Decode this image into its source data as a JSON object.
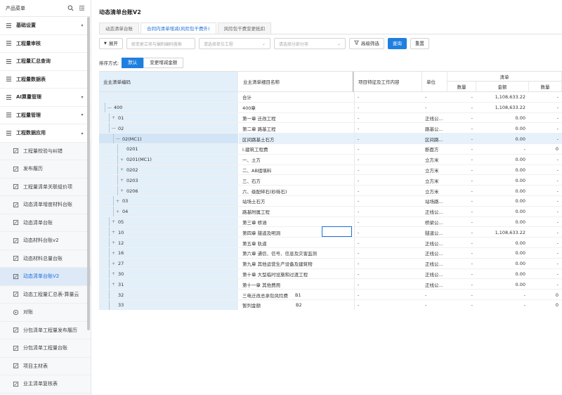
{
  "sidebar": {
    "title": "产品菜单",
    "items": [
      {
        "label": "基础设置",
        "level": 1,
        "arrow": "▾"
      },
      {
        "label": "工程量审核",
        "level": 1,
        "arrow": ""
      },
      {
        "label": "工程量汇总查询",
        "level": 1,
        "arrow": ""
      },
      {
        "label": "工程量数据表",
        "level": 1,
        "arrow": ""
      },
      {
        "label": "AI算量管理",
        "level": 1,
        "arrow": "▾"
      },
      {
        "label": "工程量管理",
        "level": 1,
        "arrow": "▾"
      },
      {
        "label": "工程数据应用",
        "level": 1,
        "arrow": "▴"
      },
      {
        "label": "工程量校验与纠错",
        "level": 2
      },
      {
        "label": "发布履历",
        "level": 2
      },
      {
        "label": "工程量清单关联组价项",
        "level": 2
      },
      {
        "label": "动态清单增度材料台账",
        "level": 2
      },
      {
        "label": "动态清单台账",
        "level": 2
      },
      {
        "label": "动态材料台账v2",
        "level": 2
      },
      {
        "label": "动态材料总量台账",
        "level": 2
      },
      {
        "label": "动态清单台账V2",
        "level": 2,
        "active": true
      },
      {
        "label": "动态工程量汇总表-算量云",
        "level": 2
      },
      {
        "label": "对账",
        "level": 2
      },
      {
        "label": "分包清单工程量发布履历",
        "level": 2
      },
      {
        "label": "分包清单工程量台账",
        "level": 2
      },
      {
        "label": "项目主材表",
        "level": 2
      },
      {
        "label": "业主清单复核表",
        "level": 2
      }
    ]
  },
  "page": {
    "title": "动态清单台账V2",
    "tabs": [
      "动态清单台账",
      "合同内清单增减(风险包干费外)",
      "风险包干费变更抵扣"
    ],
    "active_tab": 1
  },
  "toolbar": {
    "expand": "展开",
    "search_placeholder": "按变更立项与编制编码搜索",
    "unit_placeholder": "请选择单位工程",
    "sub_placeholder": "请选择分部分项",
    "advanced": "高级筛选",
    "query": "查询",
    "reset": "重置"
  },
  "sort": {
    "label": "排序方式:",
    "options": [
      "默认",
      "变更增减金额"
    ],
    "active": 0
  },
  "table": {
    "headers": {
      "code": "业主清单编码",
      "name": "业主清单细目名称",
      "feature": "项目特征及工作内容",
      "unit": "单位",
      "group": "清单",
      "qty": "数量",
      "amount": "金额",
      "qty2": "数量"
    },
    "rows": [
      {
        "code": "",
        "indent": 0,
        "name": "合计",
        "feature": "-",
        "unit": "-",
        "qty": "-",
        "amount": "1,108,633.22",
        "qty2": "-"
      },
      {
        "code": "400",
        "indent": 1,
        "toggle": "—",
        "name": "400章",
        "feature": "-",
        "unit": "-",
        "qty": "-",
        "amount": "1,108,633.22",
        "qty2": "-"
      },
      {
        "code": "01",
        "indent": 2,
        "toggle": "+",
        "name": "第一章 迁改工程",
        "feature": "-",
        "unit": "正线公...",
        "qty": "-",
        "amount": "0.00",
        "qty2": "-"
      },
      {
        "code": "02",
        "indent": 2,
        "toggle": "—",
        "name": "第二章 路基工程",
        "feature": "-",
        "unit": "路基公...",
        "qty": "-",
        "amount": "0.00",
        "qty2": "-"
      },
      {
        "code": "02(MC1)",
        "indent": 3,
        "toggle": "—",
        "name": "区间路基土石方",
        "feature": "-",
        "unit": "区间路...",
        "qty": "-",
        "amount": "0.00",
        "qty2": "-",
        "highlight": true
      },
      {
        "code": "0201",
        "indent": 4,
        "toggle": "",
        "name": "Ⅰ.建筑工程费",
        "feature": "-",
        "unit": "断面方",
        "qty": "-",
        "amount": "-",
        "qty2": "0"
      },
      {
        "code": "0201(MC1)",
        "indent": 4,
        "toggle": "+",
        "name": "一、土方",
        "feature": "-",
        "unit": "立方米",
        "qty": "-",
        "amount": "0.00",
        "qty2": "-"
      },
      {
        "code": "0202",
        "indent": 4,
        "toggle": "+",
        "name": "二、AB组填料",
        "feature": "-",
        "unit": "立方米",
        "qty": "-",
        "amount": "0.00",
        "qty2": "-"
      },
      {
        "code": "0203",
        "indent": 4,
        "toggle": "+",
        "name": "三、石方",
        "feature": "-",
        "unit": "立方米",
        "qty": "-",
        "amount": "0.00",
        "qty2": "-"
      },
      {
        "code": "0206",
        "indent": 4,
        "toggle": "+",
        "name": "六、级配碎石(砂砾石)",
        "feature": "-",
        "unit": "立方米",
        "qty": "-",
        "amount": "0.00",
        "qty2": "-"
      },
      {
        "code": "03",
        "indent": 3,
        "toggle": "+",
        "name": "站场土石方",
        "feature": "-",
        "unit": "站场路...",
        "qty": "-",
        "amount": "0.00",
        "qty2": "-"
      },
      {
        "code": "04",
        "indent": 3,
        "toggle": "+",
        "name": "路基附属工程",
        "feature": "-",
        "unit": "正线公...",
        "qty": "-",
        "amount": "0.00",
        "qty2": "-"
      },
      {
        "code": "05",
        "indent": 2,
        "toggle": "+",
        "name": "第三章 桥涵",
        "feature": "-",
        "unit": "桥梁公...",
        "qty": "-",
        "amount": "0.00",
        "qty2": "-"
      },
      {
        "code": "10",
        "indent": 2,
        "toggle": "+",
        "name": "第四章 隧道及明洞",
        "feature": "-",
        "unit": "隧道公...",
        "qty": "-",
        "amount": "1,108,633.22",
        "qty2": "-"
      },
      {
        "code": "12",
        "indent": 2,
        "toggle": "+",
        "name": "第五章 轨道",
        "feature": "-",
        "unit": "正线公...",
        "qty": "-",
        "amount": "0.00",
        "qty2": "-"
      },
      {
        "code": "16",
        "indent": 2,
        "toggle": "+",
        "name": "第六章 通信、信号、信息及灾害监测",
        "feature": "-",
        "unit": "正线公...",
        "qty": "-",
        "amount": "0.00",
        "qty2": "-"
      },
      {
        "code": "27",
        "indent": 2,
        "toggle": "+",
        "name": "第九章 其他运营生产设备及建筑物",
        "feature": "-",
        "unit": "正线公...",
        "qty": "-",
        "amount": "0.00",
        "qty2": "-"
      },
      {
        "code": "30",
        "indent": 2,
        "toggle": "+",
        "name": "第十章 大型临时设施和过渡工程",
        "feature": "-",
        "unit": "正线公...",
        "qty": "-",
        "amount": "0.00",
        "qty2": "-"
      },
      {
        "code": "31",
        "indent": 2,
        "toggle": "+",
        "name": "第十一章 其他费用",
        "feature": "-",
        "unit": "正线公...",
        "qty": "-",
        "amount": "0.00",
        "qty2": "-"
      },
      {
        "code": "32",
        "indent": 2,
        "toggle": "",
        "name": "三电迁改总承包风险费",
        "extra": "B1",
        "feature": "-",
        "unit": "-",
        "qty": "-",
        "amount": "-",
        "qty2": "0"
      },
      {
        "code": "33",
        "indent": 2,
        "toggle": "",
        "name": "暂列金额",
        "extra": "B2",
        "feature": "-",
        "unit": "-",
        "qty": "-",
        "amount": "-",
        "qty2": "0"
      }
    ]
  }
}
